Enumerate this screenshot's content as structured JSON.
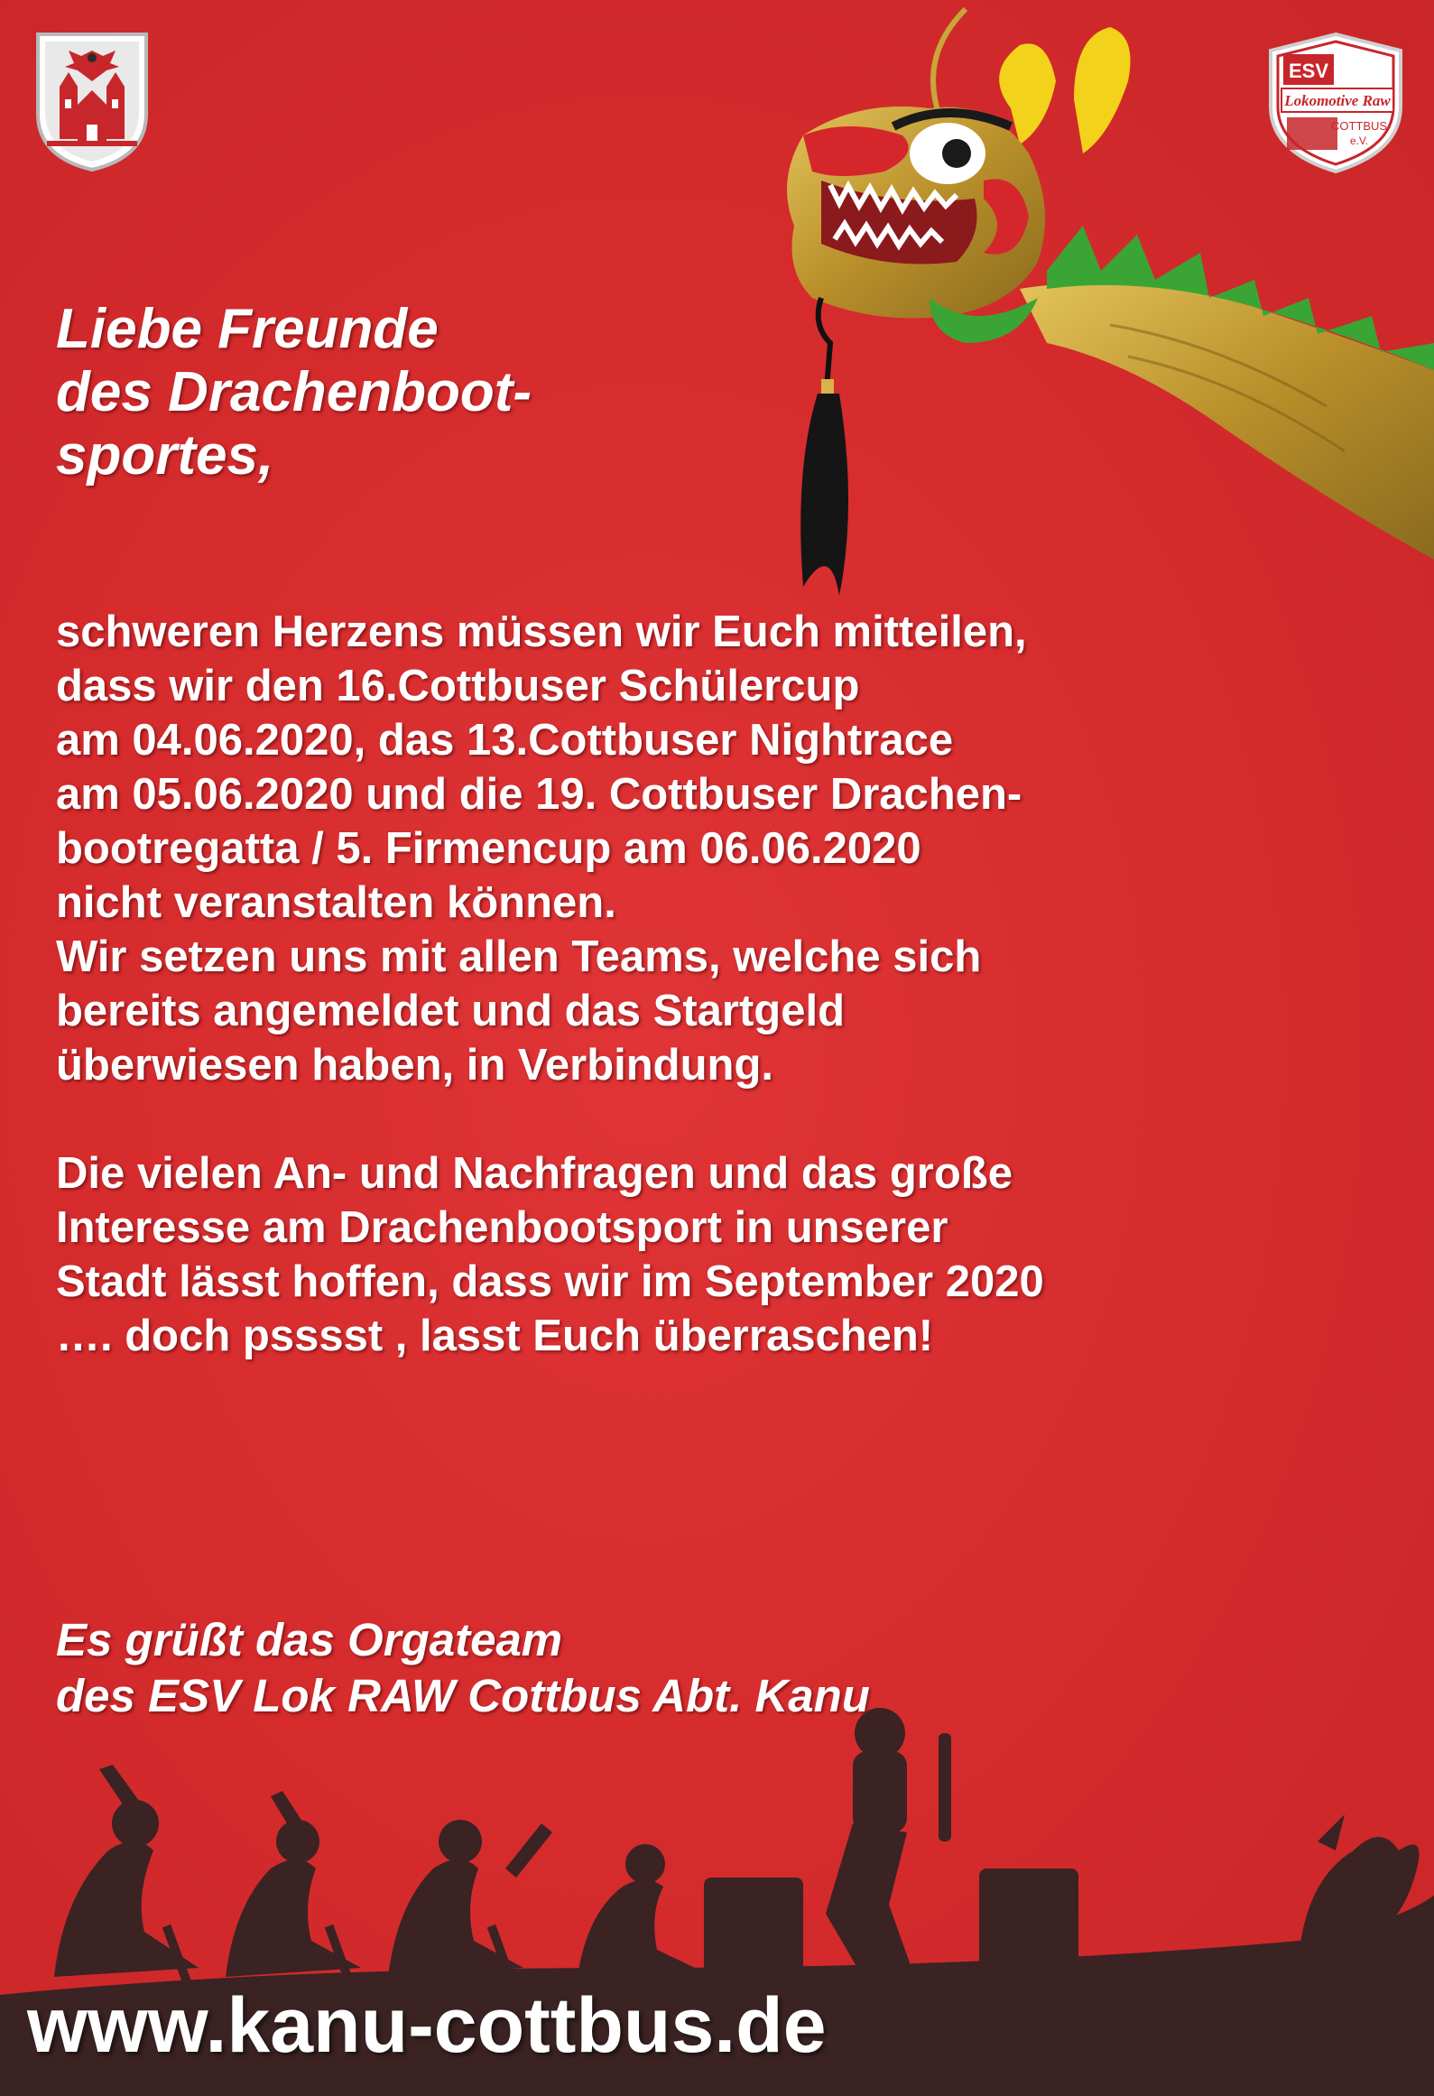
{
  "colors": {
    "background": "#d42a2c",
    "text": "#ffffff",
    "silhouette": "#3a2322",
    "dragon_gold": "#c9a53a",
    "dragon_green": "#3aa535",
    "dragon_yellow": "#f2d21a"
  },
  "emblems": {
    "left_icon": "cottbus-coat-of-arms-icon",
    "right_icon": "esv-lok-raw-club-logo-icon",
    "club_logo_top": "ESV",
    "club_logo_script": "Lokomotive Raw",
    "club_logo_city": "COTTBUS",
    "club_logo_suffix": "e.V."
  },
  "heading": {
    "lines": [
      "Liebe Freunde",
      "des Drachenboot-",
      "sportes,"
    ]
  },
  "body": {
    "paragraph1": [
      "schweren Herzens müssen wir Euch mitteilen,",
      "dass wir den 16.Cottbuser Schülercup",
      "am 04.06.2020, das 13.Cottbuser Nightrace",
      "am 05.06.2020 und die 19. Cottbuser Drachen-",
      "bootregatta / 5. Firmencup am 06.06.2020",
      "nicht veranstalten können.",
      "Wir setzen uns mit allen Teams, welche sich",
      "bereits angemeldet und das Startgeld",
      "überwiesen haben, in Verbindung."
    ],
    "paragraph2": [
      "Die vielen An- und Nachfragen und das große",
      "Interesse am Drachenbootsport in unserer",
      "Stadt lässt hoffen, dass wir im September 2020",
      " ….  doch psssst , lasst Euch überraschen!"
    ]
  },
  "greeting": {
    "lines": [
      "Es grüßt das Orgateam",
      "des ESV Lok RAW Cottbus Abt. Kanu"
    ]
  },
  "footer": {
    "url": "www.kanu-cottbus.de",
    "silhouette_icon": "dragon-boat-crew-silhouette-icon"
  }
}
